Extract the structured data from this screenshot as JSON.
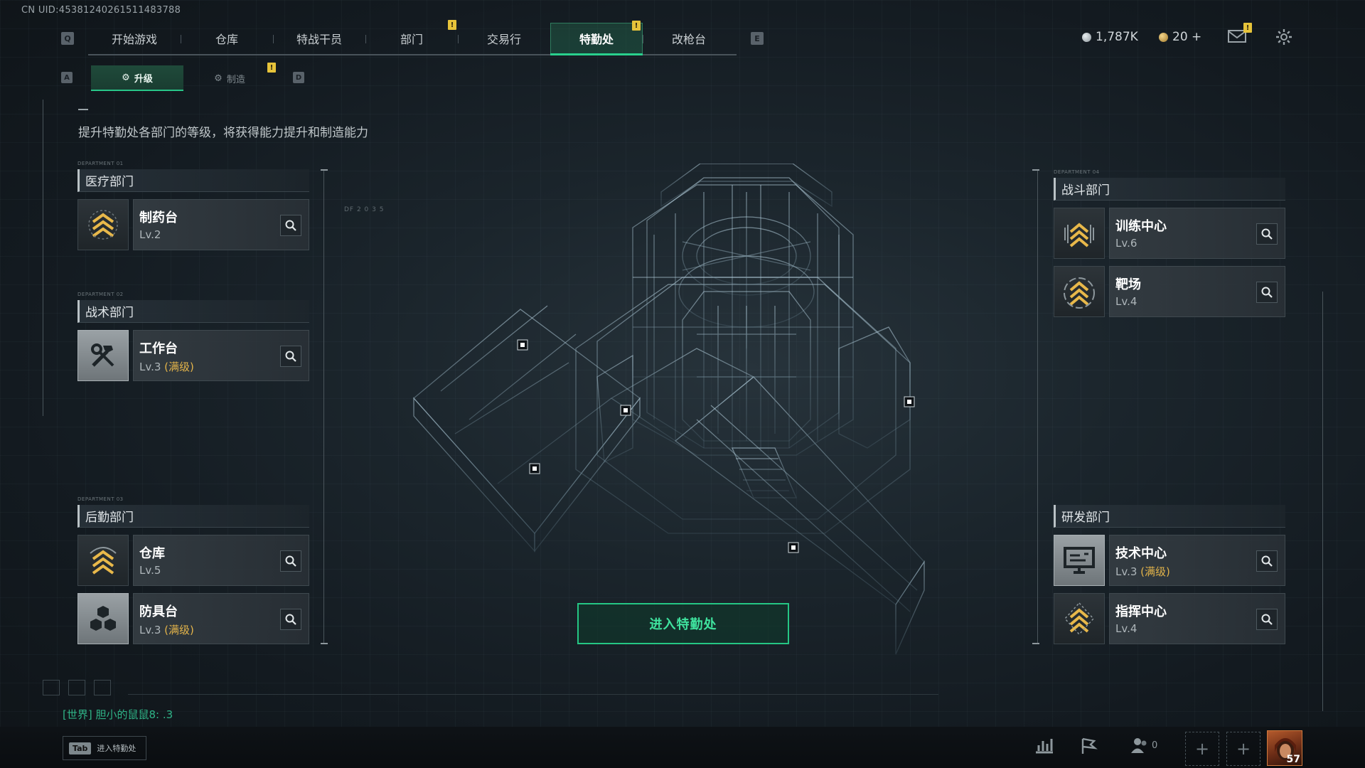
{
  "uid_text": "CN UID:4538124026151148378​8",
  "top_nav": {
    "left_key": "Q",
    "right_key": "E",
    "tabs": [
      {
        "label": "开始游戏"
      },
      {
        "label": "仓库"
      },
      {
        "label": "特战干员"
      },
      {
        "label": "部门"
      },
      {
        "label": "交易行"
      },
      {
        "label": "特勤处"
      },
      {
        "label": "改枪台"
      }
    ],
    "active_tab": "特勤处",
    "alert_mark": "!"
  },
  "currency": {
    "primary": "1,787K",
    "secondary": "20 +"
  },
  "sub_tabs": {
    "left_key": "A",
    "right_key": "D",
    "items": [
      {
        "label": "升级",
        "icon": "upgrade-gear-icon"
      },
      {
        "label": "制造",
        "icon": "craft-gear-icon"
      }
    ]
  },
  "description": "提升特勤处各部门的等级，将获得能力提升和制造能力",
  "departments": {
    "medical": {
      "tag": "DEPARTMENT 01",
      "name": "医疗部门",
      "facilities": [
        {
          "name": "制药台",
          "level": "Lv.2",
          "max": "",
          "icon": "rank-chevron-icon"
        }
      ]
    },
    "tactical": {
      "tag": "DEPARTMENT 02",
      "name": "战术部门",
      "facilities": [
        {
          "name": "工作台",
          "level": "Lv.3",
          "max": "(满级)",
          "icon": "hammer-wrench-icon"
        }
      ]
    },
    "logistics": {
      "tag": "DEPARTMENT 03",
      "name": "后勤部门",
      "facilities": [
        {
          "name": "仓库",
          "level": "Lv.5",
          "max": "",
          "icon": "rank-chevron-icon"
        },
        {
          "name": "防具台",
          "level": "Lv.3",
          "max": "(满级)",
          "icon": "cubes-icon"
        }
      ]
    },
    "combat": {
      "tag": "DEPARTMENT 04",
      "name": "战斗部门",
      "facilities": [
        {
          "name": "训练中心",
          "level": "Lv.6",
          "max": "",
          "icon": "rank-chevron-icon"
        },
        {
          "name": "靶场",
          "level": "Lv.4",
          "max": "",
          "icon": "rank-chevron-icon"
        }
      ]
    },
    "research": {
      "name": "研发部门",
      "facilities": [
        {
          "name": "技术中心",
          "level": "Lv.3",
          "max": "(满级)",
          "icon": "monitor-icon"
        },
        {
          "name": "指挥中心",
          "level": "Lv.4",
          "max": "",
          "icon": "rank-chevron-icon"
        }
      ]
    }
  },
  "enter_button": "进入特勤处",
  "chat_message": "[世界] 胆小的鼠鼠8: .3",
  "bottom_bar": {
    "tab_key": "Tab",
    "tab_hint": "进入特勤处",
    "friends_count": "0",
    "avatar_level": "57"
  },
  "hud_readout": "DF 2 0 3 5",
  "colors": {
    "accent_green": "#29d08d",
    "max_level_gold": "#e2b34a",
    "alert_yellow": "#e6c33a"
  }
}
